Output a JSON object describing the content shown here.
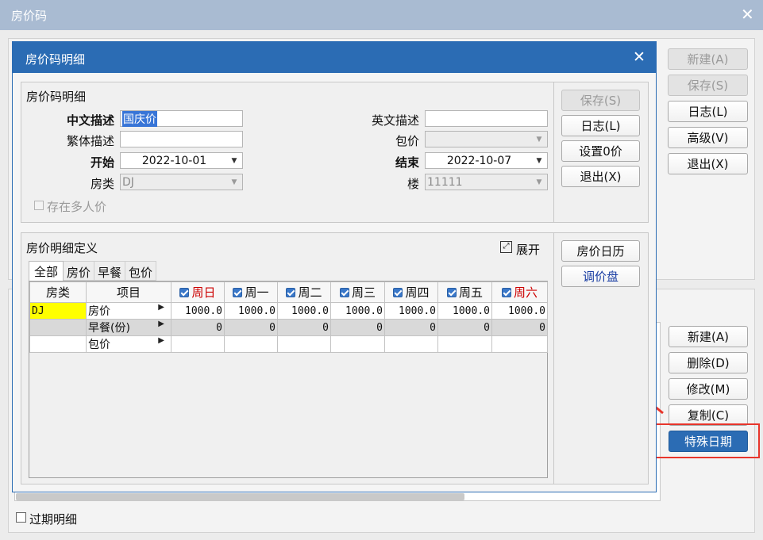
{
  "outer_window": {
    "title": "房价码",
    "right_buttons": [
      "新建(A)",
      "保存(S)",
      "日志(L)",
      "高级(V)",
      "退出(X)"
    ],
    "lower_buttons": [
      "新建(A)",
      "删除(D)",
      "修改(M)",
      "复制(C)"
    ],
    "special_button": "特殊日期",
    "expired_checkbox_label": "过期明细"
  },
  "dialog": {
    "title": "房价码明细",
    "section_title": "房价码明细",
    "fields": {
      "cn_desc_label": "中文描述",
      "cn_desc_value": "国庆价",
      "en_desc_label": "英文描述",
      "en_desc_value": "",
      "trad_desc_label": "繁体描述",
      "trad_desc_value": "",
      "package_label": "包价",
      "package_value": "",
      "start_label": "开始",
      "start_value": "2022-10-01",
      "end_label": "结束",
      "end_value": "2022-10-07",
      "room_type_label": "房类",
      "room_type_value": "DJ",
      "building_label": "楼",
      "building_value": "11111",
      "multi_person_label": "存在多人价"
    },
    "side_buttons": [
      "保存(S)",
      "日志(L)",
      "设置0价",
      "退出(X)"
    ],
    "detail_title": "房价明细定义",
    "expand_label": "展开",
    "tabs": [
      "全部",
      "房价",
      "早餐",
      "包价"
    ],
    "columns": [
      "房类",
      "项目",
      "周日",
      "周一",
      "周二",
      "周三",
      "周四",
      "周五",
      "周六"
    ],
    "rows": [
      {
        "room": "DJ",
        "item": "房价",
        "vals": [
          "1000.0",
          "1000.0",
          "1000.0",
          "1000.0",
          "1000.0",
          "1000.0",
          "1000.0"
        ]
      },
      {
        "room": "",
        "item": "早餐(份)",
        "vals": [
          "0",
          "0",
          "0",
          "0",
          "0",
          "0",
          "0"
        ]
      },
      {
        "room": "",
        "item": "包价",
        "vals": [
          "",
          "",
          "",
          "",
          "",
          "",
          ""
        ]
      }
    ],
    "right_buttons": [
      "房价日历",
      "调价盘"
    ]
  },
  "colors": {
    "title_bar": "#2b6cb4",
    "outer_title_bar": "#a9bbd2",
    "highlight_cell": "#ffff00",
    "weekend_red": "#cc0000",
    "annotation_red": "#e8352b"
  }
}
